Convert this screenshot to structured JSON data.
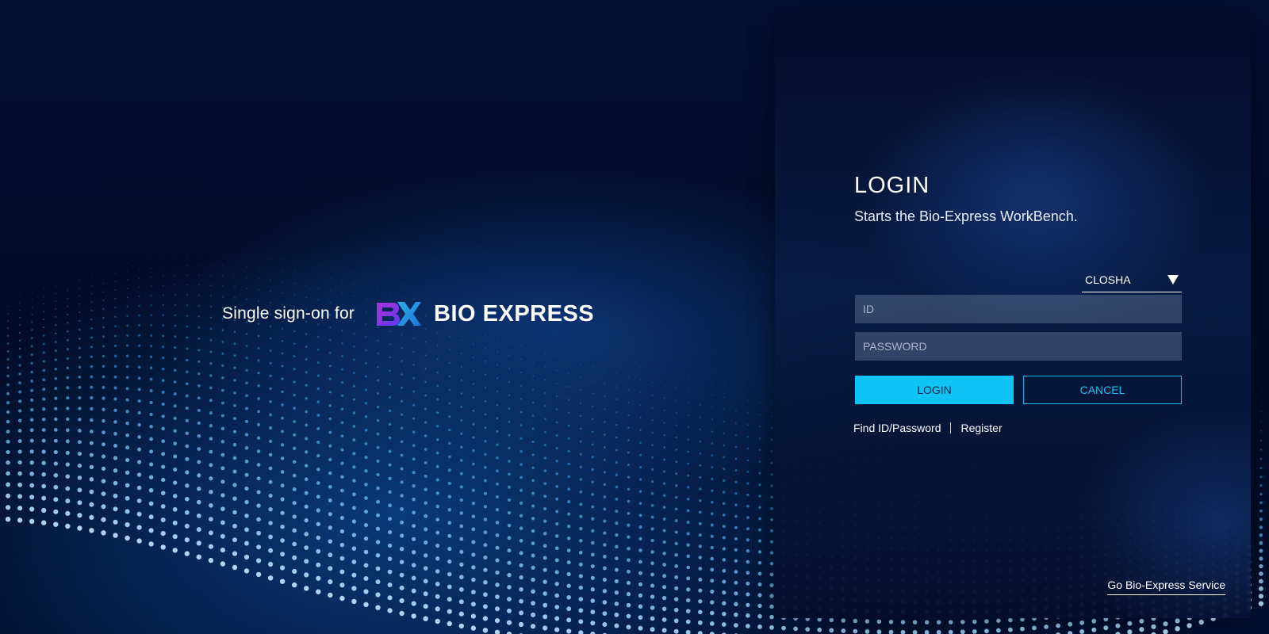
{
  "brand": {
    "prefix": "Single sign-on for",
    "logo_mark": "BX",
    "name": "BIO EXPRESS"
  },
  "login": {
    "title": "LOGIN",
    "subtitle": "Starts the Bio-Express WorkBench.",
    "service_select": {
      "selected": "CLOSHA",
      "icon": "triangle-down-icon"
    },
    "id_placeholder": "ID",
    "password_placeholder": "PASSWORD",
    "login_button": "LOGIN",
    "cancel_button": "CANCEL",
    "find_link": "Find ID/Password",
    "register_link": "Register",
    "go_service_link": "Go Bio-Express Service"
  },
  "colors": {
    "accent": "#0fc3f4",
    "background": "#020c22",
    "panel": "#07173d",
    "logo_gradient_start": "#b030d8",
    "logo_gradient_end": "#3a7cf0"
  }
}
